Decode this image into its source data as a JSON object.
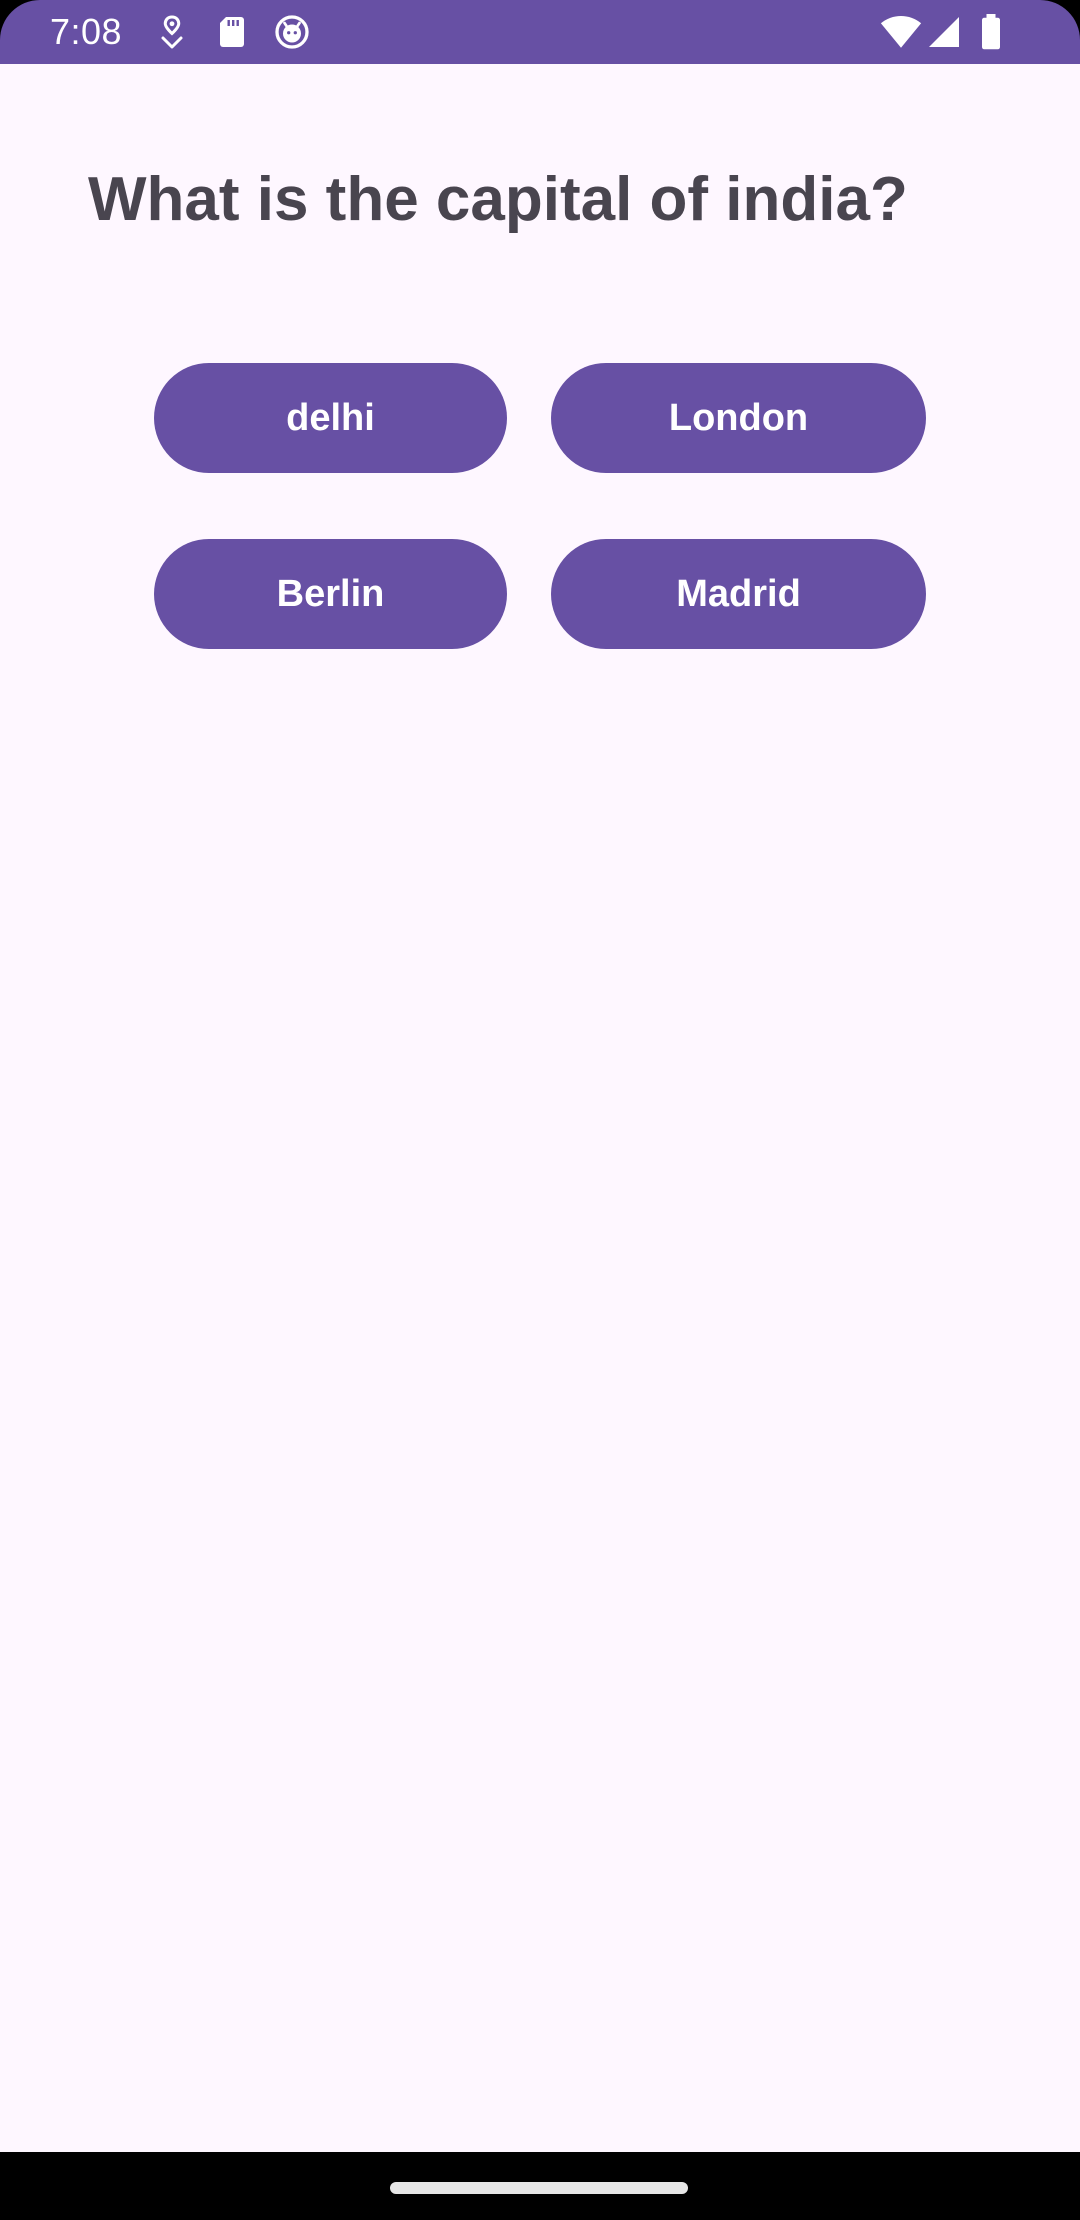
{
  "status_bar": {
    "time": "7:08",
    "icons": [
      "location-pin-icon",
      "sd-card-icon",
      "app-face-icon",
      "wifi-icon",
      "cellular-signal-icon",
      "battery-icon"
    ],
    "background_color": "#6750A4"
  },
  "question": {
    "text": "What is the capital of india?"
  },
  "answers": [
    {
      "label": "delhi"
    },
    {
      "label": "London"
    },
    {
      "label": "Berlin"
    },
    {
      "label": "Madrid"
    }
  ],
  "colors": {
    "primary": "#6750A4",
    "surface": "#FEF7FF",
    "on_surface_variant": "#49454F",
    "on_primary": "#FFFFFF"
  }
}
